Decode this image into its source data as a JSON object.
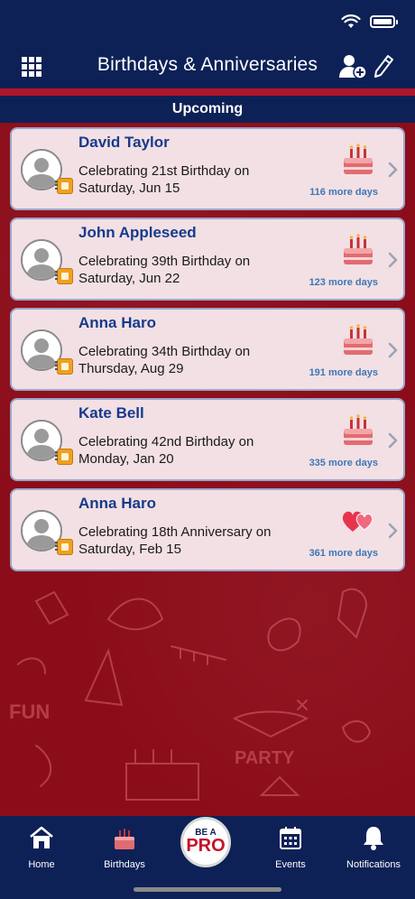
{
  "nav": {
    "title": "Birthdays & Anniversaries"
  },
  "section": {
    "title": "Upcoming"
  },
  "events": [
    {
      "name": "David Taylor",
      "line1": "Celebrating 21st Birthday on",
      "line2": "Saturday, Jun 15",
      "days": "116 more days",
      "type": "birthday"
    },
    {
      "name": "John Appleseed",
      "line1": "Celebrating 39th Birthday on",
      "line2": "Saturday, Jun 22",
      "days": "123 more days",
      "type": "birthday"
    },
    {
      "name": "Anna Haro",
      "line1": "Celebrating 34th Birthday on",
      "line2": "Thursday, Aug 29",
      "days": "191 more days",
      "type": "birthday"
    },
    {
      "name": "Kate Bell",
      "line1": "Celebrating 42nd Birthday on",
      "line2": "Monday, Jan 20",
      "days": "335 more days",
      "type": "birthday"
    },
    {
      "name": "Anna Haro",
      "line1": "Celebrating 18th Anniversary on",
      "line2": "Saturday, Feb 15",
      "days": "361 more days",
      "type": "anniversary"
    }
  ],
  "tabs": {
    "home": "Home",
    "birthdays": "Birthdays",
    "pro_top": "BE A",
    "pro_bottom": "PRO",
    "events": "Events",
    "notifications": "Notifications"
  },
  "colors": {
    "navy": "#0d2157",
    "background_red": "#8c0d1a",
    "accent_red": "#c5122a",
    "card_bg": "#f2e0e4",
    "name_blue": "#173a8c",
    "days_blue": "#3d77b8"
  },
  "icons": {
    "menu": "grid-menu-icon",
    "add": "add-person-icon",
    "edit": "pencil-icon",
    "birthday": "birthday-cake-icon",
    "anniversary": "hearts-icon"
  }
}
